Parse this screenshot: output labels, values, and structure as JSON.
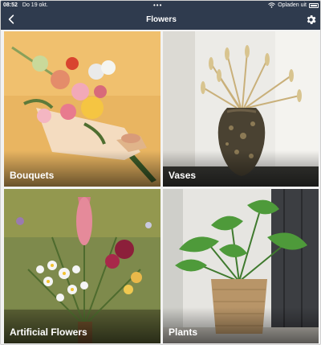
{
  "status_bar": {
    "time": "08:52",
    "date": "Do 19 okt.",
    "dots": "•••",
    "network": "Opladen uit",
    "icons": [
      "wifi-icon",
      "battery-icon"
    ]
  },
  "nav": {
    "title": "Flowers",
    "back_icon": "chevron-left-icon",
    "settings_icon": "gear-icon",
    "background": "#2f3b4e"
  },
  "categories": [
    {
      "label": "Bouquets"
    },
    {
      "label": "Vases"
    },
    {
      "label": "Artificial Flowers"
    },
    {
      "label": "Plants"
    }
  ]
}
